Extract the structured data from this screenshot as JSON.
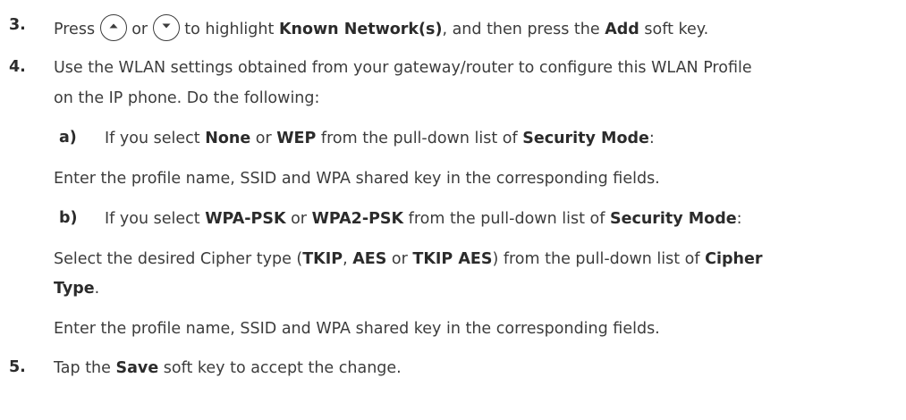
{
  "steps": {
    "s3": {
      "number": "3.",
      "t1": "Press",
      "t2": "or",
      "t3": "to highlight",
      "b1": "Known Network(s)",
      "t4": ", and then press the",
      "b2": "Add",
      "t5": "soft key."
    },
    "s4": {
      "number": "4.",
      "line1": "Use the WLAN settings obtained from your gateway/router to configure this WLAN Profile",
      "line2": "on the IP phone. Do the following:",
      "a": {
        "label": "a)",
        "t1": "If you select",
        "b1": "None",
        "t2": "or",
        "b2": "WEP",
        "t3": "from the pull-down list of",
        "b3": "Security Mode",
        "t4": ":",
        "detail": "Enter the profile name, SSID and WPA shared key in the corresponding fields."
      },
      "b": {
        "label": "b)",
        "t1": "If you select",
        "b1": "WPA-PSK",
        "t2": "or",
        "b2": "WPA2-PSK",
        "t3": "from the pull-down list of",
        "b3": "Security Mode",
        "t4": ":",
        "c1": "Select the desired Cipher type (",
        "cb1": "TKIP",
        "c2": ",",
        "cb2": "AES",
        "c3": "or",
        "cb3": "TKIP AES",
        "c4": ") from the pull-down list of",
        "cb4": "Cipher",
        "cb5": "Type",
        "c5": ".",
        "detail": "Enter the profile name, SSID and WPA shared key in the corresponding fields."
      }
    },
    "s5": {
      "number": "5.",
      "t1": "Tap the",
      "b1": "Save",
      "t2": "soft key to accept the change."
    }
  },
  "icons": {
    "up_key": "up-arrow-key-icon",
    "down_key": "down-arrow-key-icon"
  }
}
